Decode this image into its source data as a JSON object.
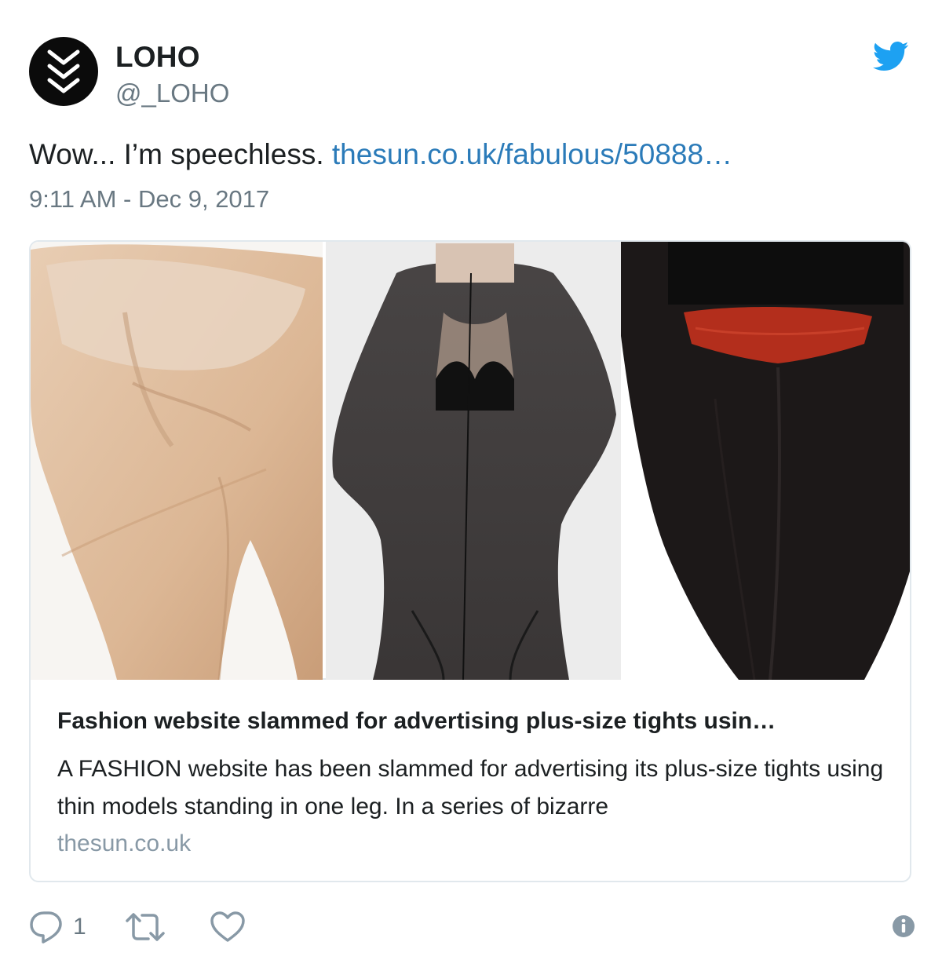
{
  "account": {
    "name": "LOHO",
    "handle": "@_LOHO"
  },
  "tweet": {
    "text": "Wow... I’m speechless. ",
    "link_text": "thesun.co.uk/fabulous/50888…",
    "timestamp": "9:11 AM - Dec 9, 2017"
  },
  "card": {
    "title": "Fashion website slammed for advertising plus-size tights usin…",
    "description": "A FASHION website has been slammed for advertising its plus-size tights using thin models standing in one leg. In a series of bizarre",
    "domain": "thesun.co.uk"
  },
  "actions": {
    "reply_count": "1",
    "reply_icon": "speech-bubble-icon",
    "retweet_icon": "retweet-icon",
    "like_icon": "heart-icon",
    "info_icon": "info-icon"
  },
  "colors": {
    "link": "#2b7bb9",
    "twitter_blue": "#1da1f2",
    "muted": "#697882",
    "border": "#e1e8ed"
  }
}
